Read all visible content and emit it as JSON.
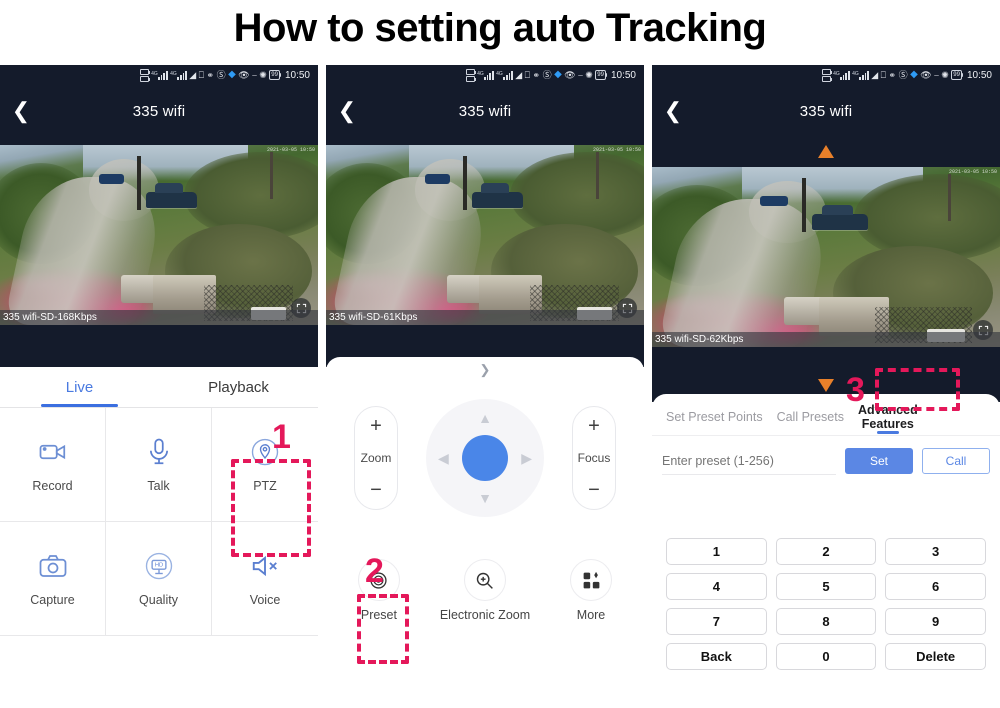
{
  "title": "How to setting auto Tracking",
  "status_bar": {
    "time": "10:50",
    "battery": "99",
    "icons": [
      "sim-card-icon",
      "signal-4g-icon",
      "signal-4g-icon-2",
      "wifi-icon",
      "sync-icon",
      "vpn-icon",
      "dnd-icon",
      "location-icon",
      "eye-icon",
      "nfc-icon",
      "bluetooth-icon",
      "battery-icon"
    ]
  },
  "panels": [
    {
      "nav": {
        "back_icon": "chevron-left-icon",
        "title": "335 wifi"
      },
      "video": {
        "bitrate_label": "335 wifi-SD-168Kbps",
        "osd_timestamp": "2021-03-05 10:50",
        "fullscreen_icon": "fullscreen-icon"
      },
      "tabs": [
        {
          "label": "Live",
          "active": true
        },
        {
          "label": "Playback",
          "active": false
        }
      ],
      "grid": [
        {
          "label": "Record",
          "icon": "video-camera-icon"
        },
        {
          "label": "Talk",
          "icon": "microphone-icon"
        },
        {
          "label": "PTZ",
          "icon": "location-pin-icon",
          "highlighted": true
        },
        {
          "label": "Capture",
          "icon": "camera-icon"
        },
        {
          "label": "Quality",
          "icon": "hd-monitor-icon"
        },
        {
          "label": "Voice",
          "icon": "speaker-mute-icon"
        }
      ]
    },
    {
      "nav": {
        "back_icon": "chevron-left-icon",
        "title": "335 wifi"
      },
      "video": {
        "bitrate_label": "335 wifi-SD-61Kbps",
        "osd_timestamp": "2021-03-05 10:50",
        "fullscreen_icon": "fullscreen-icon"
      },
      "collapse_icon": "chevron-down-icon",
      "zoom": {
        "label": "Zoom",
        "plus": "+",
        "minus": "−"
      },
      "focus": {
        "label": "Focus",
        "plus": "+",
        "minus": "−"
      },
      "dpad": {
        "up_icon": "chevron-up-icon",
        "down_icon": "chevron-down-icon",
        "left_icon": "chevron-left-icon",
        "right_icon": "chevron-right-icon",
        "center": "joystick-center"
      },
      "actions": [
        {
          "label": "Preset",
          "icon": "preset-target-icon",
          "highlighted": true
        },
        {
          "label": "Electronic Zoom",
          "icon": "zoom-in-icon"
        },
        {
          "label": "More",
          "icon": "grid-more-icon"
        }
      ]
    },
    {
      "nav": {
        "back_icon": "chevron-left-icon",
        "title": "335 wifi"
      },
      "video": {
        "bitrate_label": "335 wifi-SD-62Kbps",
        "osd_timestamp": "2021-03-05 10:50",
        "fullscreen_icon": "fullscreen-icon",
        "ptz_arrows": [
          "arrow-up",
          "arrow-down",
          "arrow-left",
          "arrow-right"
        ]
      },
      "preset_tabs": [
        {
          "label": "Set Preset Points",
          "active": false
        },
        {
          "label": "Call Presets",
          "active": false
        },
        {
          "label_line1": "Advanced",
          "label_line2": "Features",
          "active": true,
          "highlighted": true
        }
      ],
      "preset_input": {
        "placeholder": "Enter preset (1-256)",
        "value": ""
      },
      "buttons": {
        "set": "Set",
        "call": "Call"
      },
      "keypad": [
        "1",
        "2",
        "3",
        "4",
        "5",
        "6",
        "7",
        "8",
        "9",
        "Back",
        "0",
        "Delete"
      ]
    }
  ],
  "annotations": [
    {
      "number": "1",
      "target": "ptz-button"
    },
    {
      "number": "2",
      "target": "preset-button"
    },
    {
      "number": "3",
      "target": "advanced-features-tab"
    }
  ],
  "colors": {
    "annotation": "#e4185a",
    "accent_blue": "#4a7ae0",
    "ptz_arrow": "#e8802a",
    "phone_header": "#141b2b"
  }
}
